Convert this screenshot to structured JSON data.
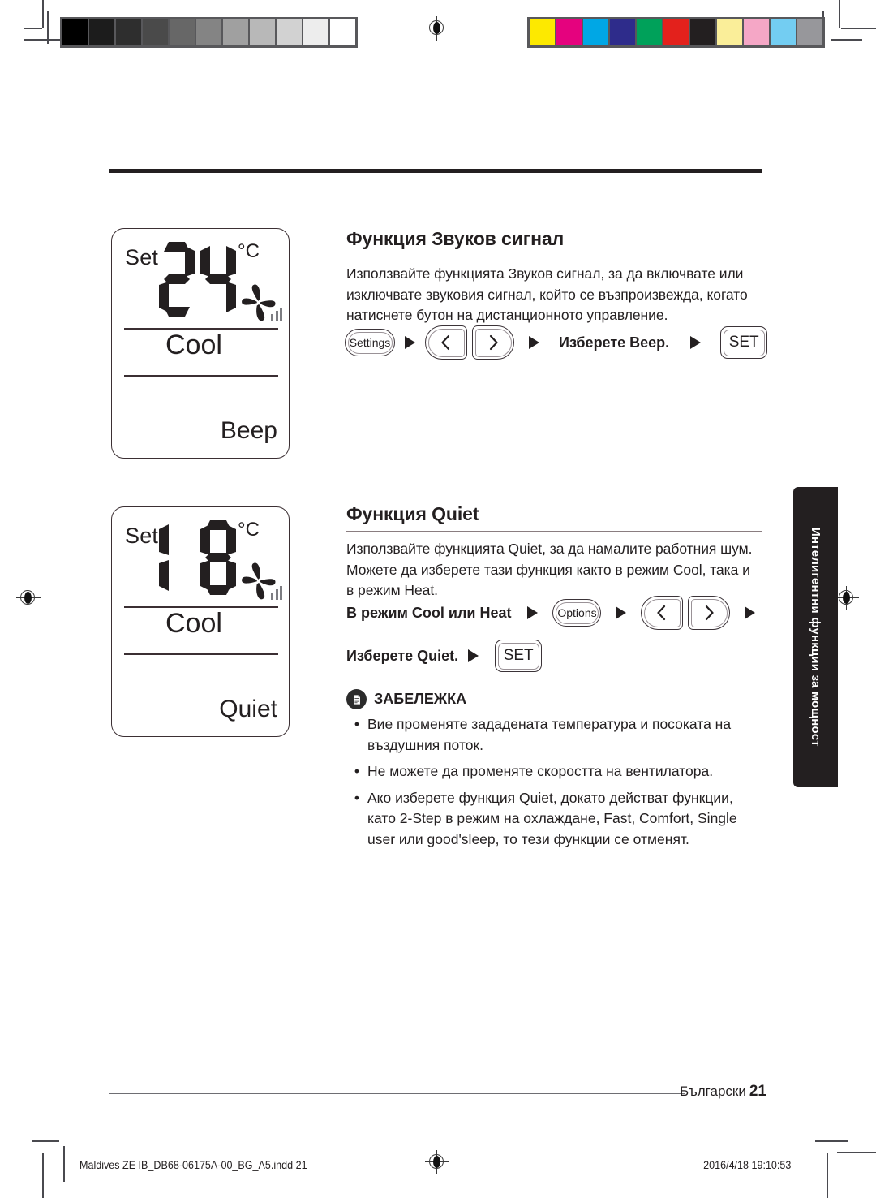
{
  "page": {
    "language_label": "Български",
    "page_number": "21",
    "side_tab_label": "Интелигентни функции за мощност"
  },
  "print_marks": {
    "gray_wedge": [
      "#000000",
      "#1c1c1c",
      "#2e2e2e",
      "#4a4a4a",
      "#676767",
      "#848484",
      "#a0a0a0",
      "#b8b8b8",
      "#d2d2d2",
      "#ededed",
      "#ffffff"
    ],
    "color_bar": [
      "#fde900",
      "#e5027e",
      "#00a7e5",
      "#2e2c8b",
      "#00a15a",
      "#e3211c",
      "#231f20",
      "#faee99",
      "#f5a7c6",
      "#73cdf2",
      "#97979b"
    ]
  },
  "lcd_beep": {
    "set_label": "Set",
    "temperature": "24",
    "unit": "°C",
    "mode": "Cool",
    "function": "Beep"
  },
  "lcd_quiet": {
    "set_label": "Set",
    "temperature": "18",
    "unit": "°C",
    "mode": "Cool",
    "function": "Quiet"
  },
  "section_beep": {
    "title": "Функция Звуков сигнал",
    "body": "Използвайте функцията Звуков сигнал, за да включвате или изключвате звуковия сигнал, който се възпроизвежда, когато натиснете бутон на дистанционното управление.",
    "steps": {
      "settings_button": "Settings",
      "select_text": "Изберете Beep.",
      "set_button": "SET"
    }
  },
  "section_quiet": {
    "title": "Функция Quiet",
    "body": "Използвайте функцията Quiet, за да намалите работния шум. Можете да изберете тази функция както в режим Cool, така и в режим Heat.",
    "steps": {
      "mode_text": "В режим Cool или Heat",
      "options_button": "Options",
      "select_text": "Изберете Quiet.",
      "set_button": "SET"
    }
  },
  "note": {
    "title": "ЗАБЕЛЕЖКА",
    "bullet": "•",
    "items": [
      "Вие променяте зададената температура и посоката на въздушния поток.",
      "Не можете да променяте скоростта на вентилатора.",
      "Ако изберете функция Quiet, докато действат функции, като 2-Step в режим на охлаждане, Fast, Comfort, Single user или good'sleep, то тези функции се отменят."
    ]
  },
  "slug": {
    "left": "Maldives ZE IB_DB68-06175A-00_BG_A5.indd   21",
    "right": "2016/4/18   19:10:53"
  }
}
